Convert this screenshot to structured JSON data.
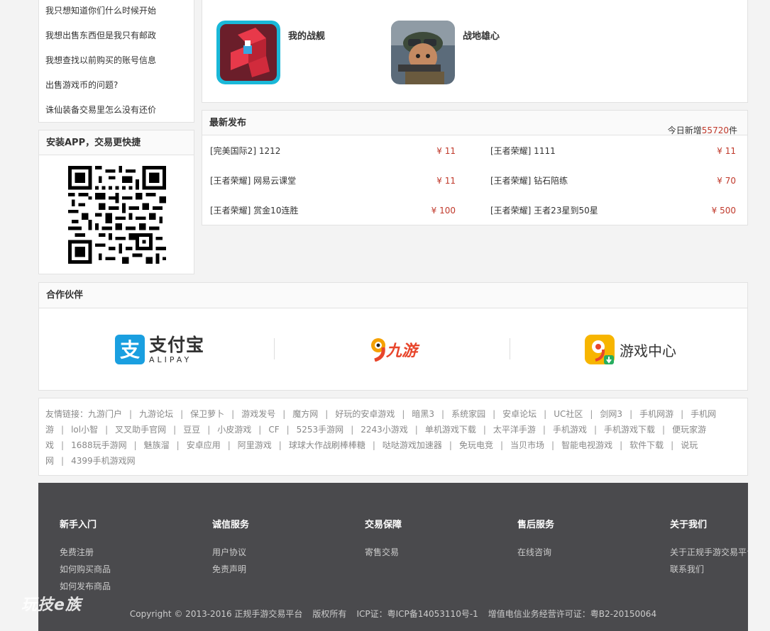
{
  "faq": {
    "items": [
      "我只想知道你们什么时候开始",
      "我想出售东西但是我只有邮政",
      "我想查找以前购买的账号信息",
      "出售游戏币的问题?",
      "诛仙装备交易里怎么没有还价"
    ]
  },
  "app": {
    "title": "安装APP，交易更快捷"
  },
  "games": [
    {
      "name": "我的战舰",
      "icon": "game-icon-battleship"
    },
    {
      "name": "战地雄心",
      "icon": "game-icon-soldier"
    }
  ],
  "latest": {
    "title": "最新发布",
    "count_prefix": "今日新增",
    "count": "55720",
    "count_suffix": "件",
    "items": [
      {
        "name": "[完美国际2] 1212",
        "price": "¥ 11"
      },
      {
        "name": "[王者荣耀] 1111",
        "price": "¥ 11"
      },
      {
        "name": "[王者荣耀] 网易云课堂",
        "price": "¥ 11"
      },
      {
        "name": "[王者荣耀] 钻石陪练",
        "price": "¥ 70"
      },
      {
        "name": "[王者荣耀] 赏金10连胜",
        "price": "¥ 100"
      },
      {
        "name": "[王者荣耀] 王者23星到50星",
        "price": "¥ 500"
      }
    ]
  },
  "partners": {
    "title": "合作伙伴",
    "alipay": {
      "cn": "支付宝",
      "en": "ALIPAY"
    },
    "jiuyou": "九游",
    "gamecenter": "游戏中心"
  },
  "links": {
    "label": "友情链接：",
    "items": [
      "九游门户",
      "九游论坛",
      "保卫萝卜",
      "游戏发号",
      "魔方网",
      "好玩的安卓游戏",
      "暗黑3",
      "系统家园",
      "安卓论坛",
      "UC社区",
      "剑网3",
      "手机网游",
      "手机网游",
      "lol小智",
      "叉叉助手官网",
      "豆豆",
      "小皮游戏",
      "CF",
      "5253手游网",
      "2243小游戏",
      "单机游戏下载",
      "太平洋手游",
      "手机游戏",
      "手机游戏下载",
      "便玩家游戏",
      "1688玩手游网",
      "魅族溜",
      "安卓应用",
      "阿里游戏",
      "球球大作战刷棒棒糖",
      "哒哒游戏加速器",
      "免玩电竞",
      "当贝市场",
      "智能电视游戏",
      "软件下载",
      "说玩网",
      "4399手机游戏网"
    ]
  },
  "footer": {
    "cols": [
      {
        "title": "新手入门",
        "links": [
          "免费注册",
          "如何购买商品",
          "如何发布商品"
        ]
      },
      {
        "title": "诚信服务",
        "links": [
          "用户协议",
          "免责声明"
        ]
      },
      {
        "title": "交易保障",
        "links": [
          "寄售交易"
        ]
      },
      {
        "title": "售后服务",
        "links": [
          "在线咨询"
        ]
      },
      {
        "title": "关于我们",
        "links": [
          "关于正规手游交易平台",
          "联系我们"
        ]
      }
    ],
    "copyright": "Copyright © 2013-2016 正规手游交易平台",
    "rights": "版权所有",
    "icp": "ICP证：粤ICP备14053110号-1",
    "license": "增值电信业务经营许可证：粤B2-20150064"
  },
  "watermark": "玩技e族",
  "colors": {
    "price": "#c0392b",
    "footer_bg": "#4a4a4d",
    "alipay_blue": "#1a9fe0",
    "gamecenter_yellow": "#f7b500"
  }
}
